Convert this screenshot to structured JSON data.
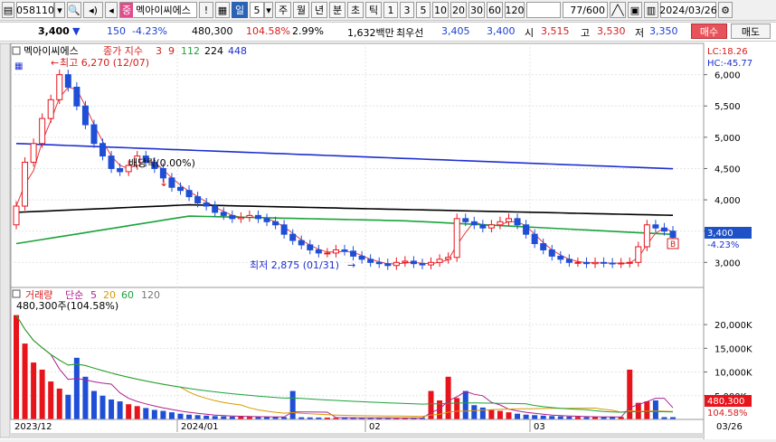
{
  "toolbar": {
    "code": "058110",
    "name": "멕아이씨에스",
    "name_tag": "중",
    "period_label": "일",
    "period_value": "5",
    "periods": [
      "주",
      "월",
      "년",
      "분",
      "초",
      "틱"
    ],
    "intervals": [
      "1",
      "3",
      "5",
      "10",
      "20",
      "30",
      "60",
      "120"
    ],
    "count": "77/600",
    "date": "2024/03/26",
    "alert": "!"
  },
  "quote": {
    "price": "3,400",
    "change": "150",
    "change_pct": "-4.23%",
    "volume": "480,300",
    "volume_ratio": "104.58%",
    "turnover": "2.99%",
    "amount": "1,632백만",
    "best_label": "최우선",
    "best_ask": "3,405",
    "best_bid": "3,400",
    "open_label": "시",
    "open": "3,515",
    "high_label": "고",
    "high": "3,530",
    "low_label": "저",
    "low": "3,350",
    "buy_label": "매수",
    "sell_label": "매도"
  },
  "price_panel": {
    "title": "멕아이씨에스",
    "legend_label": "종가 지수",
    "legend_periods": [
      "3",
      "9",
      "112",
      "224",
      "448"
    ],
    "high_annot": "최고 6,270 (12/07)",
    "low_annot": "최저 2,875 (01/31)",
    "dividend_annot": "배당락(0.00%)",
    "lc_label": "LC:18.26",
    "hc_label": "HC:-45.77",
    "current_price": "3,400",
    "current_pct": "-4.23%",
    "b_marker": "B",
    "y_ticks": [
      "6,000",
      "5,500",
      "5,000",
      "4,500",
      "4,000",
      "3,500",
      "3,000"
    ]
  },
  "volume_panel": {
    "title": "거래량",
    "legend_label": "단순",
    "legend_periods": [
      "5",
      "20",
      "60",
      "120"
    ],
    "current_annot": "480,300주(104.58%)",
    "current_value": "480,300",
    "current_pct": "104.58%",
    "y_ticks": [
      "20,000K",
      "15,000K",
      "10,000K",
      "5,000K"
    ]
  },
  "x_axis": {
    "labels": [
      "2023/12",
      "2024/01",
      "02",
      "03",
      "03/26"
    ]
  },
  "colors": {
    "up": "#e8141c",
    "down": "#1f4fd6",
    "ma3": "#e23a3a",
    "ma112": "#1aa33a",
    "ma224": "#000000",
    "ma448": "#1e2fd0"
  }
}
